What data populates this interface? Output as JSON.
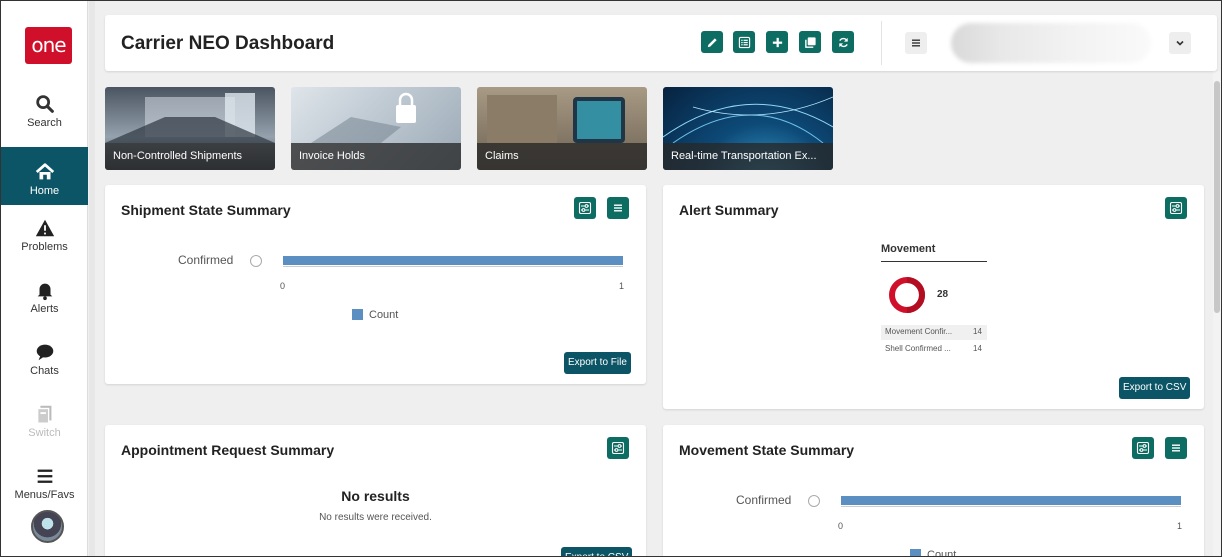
{
  "app": {
    "logo_text": "one",
    "brand_color": "#d0102a",
    "accent": "#0e6d63"
  },
  "sidebar": {
    "items": [
      {
        "label": "Search",
        "icon": "search-icon"
      },
      {
        "label": "Home",
        "icon": "home-icon",
        "active": true
      },
      {
        "label": "Problems",
        "icon": "warning-icon"
      },
      {
        "label": "Alerts",
        "icon": "bell-icon"
      },
      {
        "label": "Chats",
        "icon": "chat-icon"
      },
      {
        "label": "Switch",
        "icon": "switch-icon",
        "disabled": true
      },
      {
        "label": "Menus/Favs",
        "icon": "hamburger-icon"
      }
    ]
  },
  "header": {
    "title": "Carrier NEO Dashboard",
    "actions": [
      "edit-icon",
      "list-icon",
      "plus-icon",
      "copy-icon",
      "refresh-icon"
    ]
  },
  "tiles": [
    {
      "label": "Non-Controlled Shipments"
    },
    {
      "label": "Invoice Holds"
    },
    {
      "label": "Claims"
    },
    {
      "label": "Real-time Transportation Ex..."
    }
  ],
  "shipment_state": {
    "title": "Shipment State Summary",
    "bar_label": "Confirmed",
    "tick_min": "0",
    "tick_max": "1",
    "legend": "Count",
    "export_label": "Export to File"
  },
  "alert_summary": {
    "title": "Alert Summary",
    "chart_title": "Movement",
    "total": "28",
    "rows": [
      {
        "label": "Movement Confir...",
        "value": "14"
      },
      {
        "label": "Shell Confirmed ...",
        "value": "14"
      }
    ],
    "export_label": "Export to CSV"
  },
  "appointment_request": {
    "title": "Appointment Request Summary",
    "empty_title": "No results",
    "empty_text": "No results were received.",
    "export_label": "Export to CSV"
  },
  "movement_state": {
    "title": "Movement State Summary",
    "bar_label": "Confirmed",
    "tick_min": "0",
    "tick_max": "1",
    "legend": "Count"
  },
  "chart_data": [
    {
      "type": "bar",
      "categories": [
        "Confirmed"
      ],
      "series": [
        {
          "name": "Count",
          "values": [
            1
          ]
        }
      ],
      "xlim": [
        0,
        1
      ],
      "title": "Shipment State Summary"
    },
    {
      "type": "pie",
      "categories": [
        "Movement Confir...",
        "Shell Confirmed ..."
      ],
      "values": [
        14,
        14
      ],
      "title": "Movement"
    },
    {
      "type": "bar",
      "categories": [
        "Confirmed"
      ],
      "series": [
        {
          "name": "Count",
          "values": [
            1
          ]
        }
      ],
      "xlim": [
        0,
        1
      ],
      "title": "Movement State Summary"
    }
  ]
}
